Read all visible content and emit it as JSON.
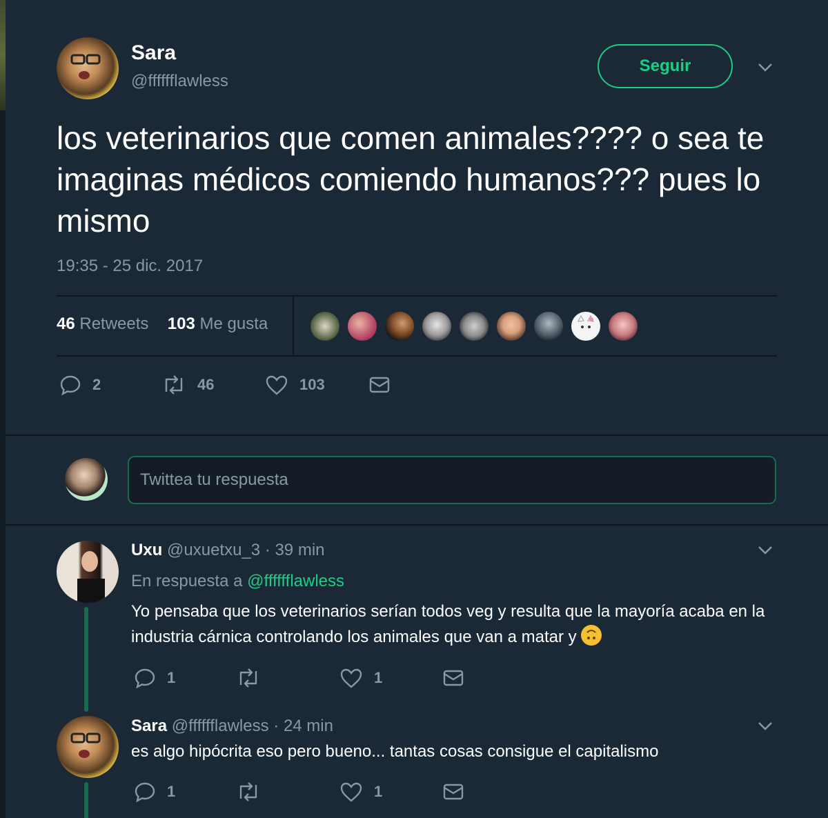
{
  "tweet": {
    "author_name": "Sara",
    "author_handle": "@fffffflawless",
    "follow_label": "Seguir",
    "text": "los veterinarios que comen animales???? o sea te imaginas médicos comiendo humanos??? pues lo mismo",
    "timestamp": "19:35 - 25 dic. 2017",
    "retweets_count": "46",
    "retweets_label": "Retweets",
    "likes_count": "103",
    "likes_label": "Me gusta",
    "actions": {
      "replies": "2",
      "retweets": "46",
      "likes": "103"
    }
  },
  "likers": [
    {
      "color": "#4a5a3a"
    },
    {
      "color": "#b0385f"
    },
    {
      "color": "#7a4b2a"
    },
    {
      "color": "#c9c9c9"
    },
    {
      "color": "#8a8a8a"
    },
    {
      "color": "#d9a07f"
    },
    {
      "color": "#4d5a66"
    },
    {
      "color": "#f4f4f4"
    },
    {
      "color": "#c77a80"
    }
  ],
  "compose": {
    "placeholder": "Twittea tu respuesta"
  },
  "replies": [
    {
      "name": "Uxu",
      "meta": "@uxuetxu_3 · 39 min",
      "reply_to_prefix": "En respuesta a",
      "reply_to_handle": "@fffffflawless",
      "text": "Yo pensaba que los veterinarios serían todos veg y resulta que la mayoría acaba en la industria cárnica controlando los animales que van a matar y",
      "emoji": "upside-down-face-emoji",
      "reply_count": "1",
      "retweet_count": "",
      "like_count": "1"
    },
    {
      "name": "Sara",
      "meta": "@fffffflawless · 24 min",
      "text": "es algo hipócrita eso pero bueno... tantas cosas consigue el capitalismo",
      "reply_count": "1",
      "retweet_count": "",
      "like_count": "1"
    }
  ],
  "colors": {
    "background": "#1b2836",
    "accent": "#19cf86",
    "muted": "#8899a6"
  }
}
